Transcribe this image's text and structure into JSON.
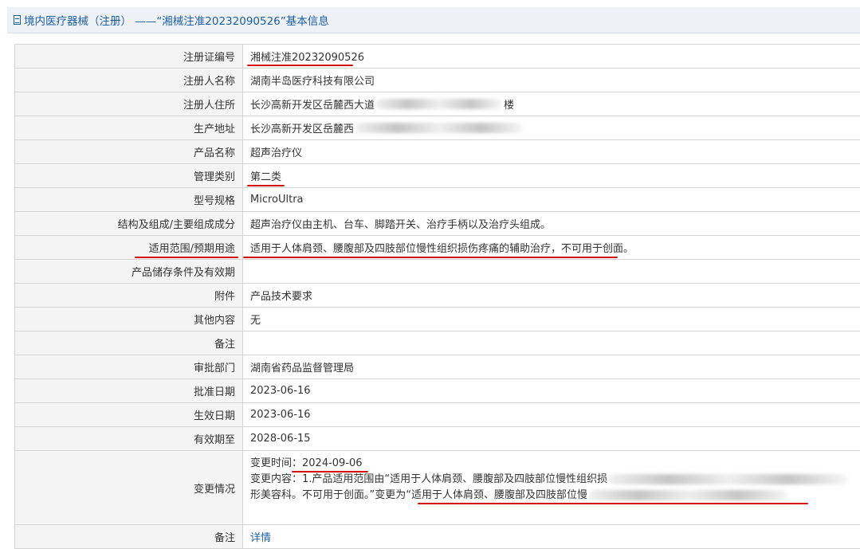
{
  "header": {
    "title": "境内医疗器械（注册） ——“湘械注准20232090526”基本信息"
  },
  "rows": [
    {
      "label": "注册证编号",
      "value": "湘械注准20232090526"
    },
    {
      "label": "注册人名称",
      "value": "湖南半岛医疗科技有限公司"
    },
    {
      "label": "注册人住所",
      "value": "长沙高新开发区岳麓西大道",
      "value_tail": "楼"
    },
    {
      "label": "生产地址",
      "value": "长沙高新开发区岳麓西"
    },
    {
      "label": "产品名称",
      "value": "超声治疗仪"
    },
    {
      "label": "管理类别",
      "value": "第二类"
    },
    {
      "label": "型号规格",
      "value": "MicroUltra"
    },
    {
      "label": "结构及组成/主要组成成分",
      "value": "超声治疗仪由主机、台车、脚踏开关、治疗手柄以及治疗头组成。"
    },
    {
      "label": "适用范围/预期用途",
      "value": "适用于人体肩颈、腰腹部及四肢部位慢性组织损伤疼痛的辅助治疗，不可用于创面。"
    },
    {
      "label": "产品储存条件及有效期",
      "value": ""
    },
    {
      "label": "附件",
      "value": "产品技术要求"
    },
    {
      "label": "其他内容",
      "value": "无"
    },
    {
      "label": "备注",
      "value": ""
    },
    {
      "label": "审批部门",
      "value": "湖南省药品监督管理局"
    },
    {
      "label": "批准日期",
      "value": "2023-06-16"
    },
    {
      "label": "生效日期",
      "value": "2023-06-16"
    },
    {
      "label": "有效期至",
      "value": "2028-06-15"
    }
  ],
  "change": {
    "label": "变更情况",
    "line1": "变更时间：2024-09-06",
    "line2": "变更内容：1.产品适用范围由“适用于人体肩颈、腰腹部及四肢部位慢性组织损",
    "line3a": "形美容科。不可用于创面。”变更为",
    "line3b": "“适用于人体肩颈、腰腹部及四肢部位慢"
  },
  "last_row": {
    "label": "备注",
    "value": "详情"
  },
  "colors": {
    "accent": "#1b5fa6",
    "underline": "#d41010"
  }
}
